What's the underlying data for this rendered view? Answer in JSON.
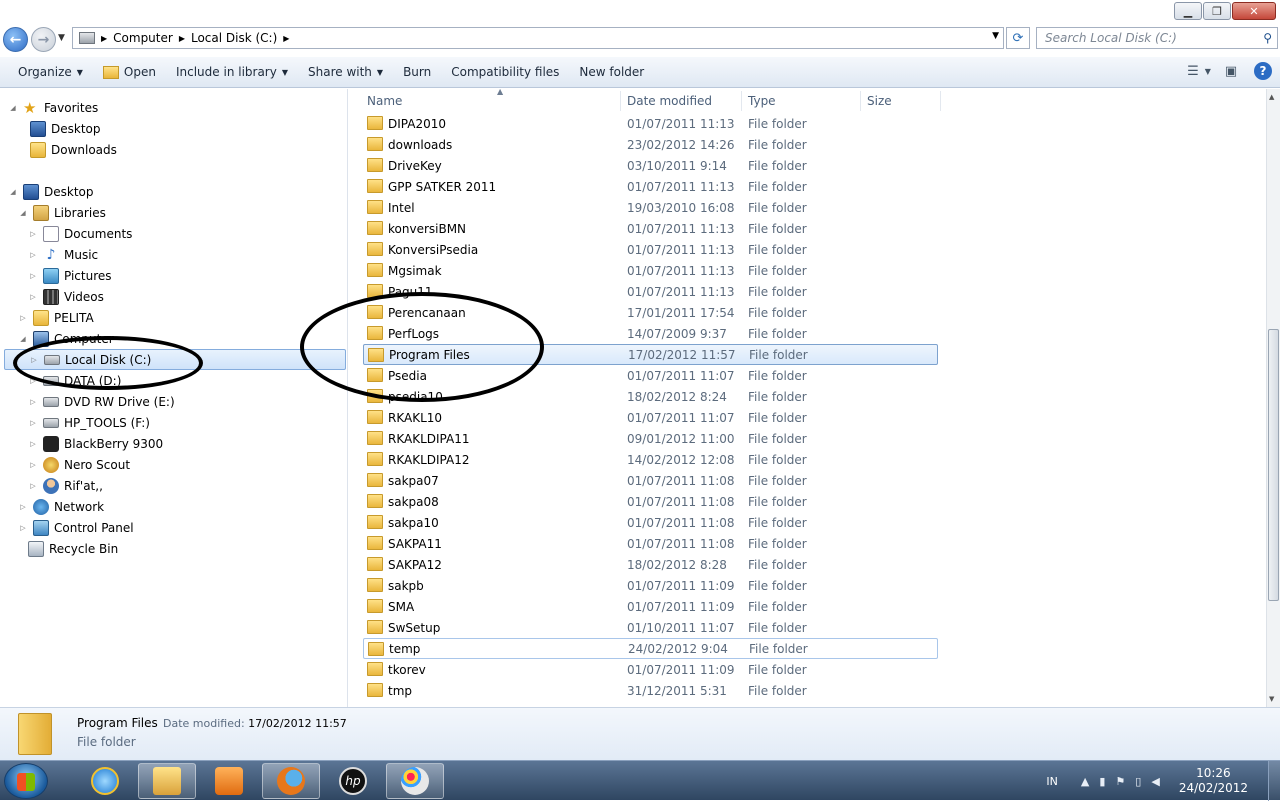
{
  "addressbar": {
    "segments": [
      "Computer",
      "Local Disk (C:)"
    ],
    "search_placeholder": "Search Local Disk (C:)"
  },
  "toolbar": {
    "organize": "Organize",
    "open": "Open",
    "include": "Include in library",
    "share": "Share with",
    "burn": "Burn",
    "compat": "Compatibility files",
    "newfolder": "New folder"
  },
  "nav": {
    "favorites": "Favorites",
    "fav_desktop": "Desktop",
    "fav_downloads": "Downloads",
    "desktop": "Desktop",
    "libraries": "Libraries",
    "documents": "Documents",
    "music": "Music",
    "pictures": "Pictures",
    "videos": "Videos",
    "pelita": "PELITA",
    "computer": "Computer",
    "local_disk": "Local Disk (C:)",
    "data_d": "DATA (D:)",
    "dvd": "DVD RW Drive (E:)",
    "hp_tools": "HP_TOOLS (F:)",
    "blackberry": "BlackBerry 9300",
    "nero": "Nero Scout",
    "rifat": "Rif'at,,",
    "network": "Network",
    "control_panel": "Control Panel",
    "recycle_bin": "Recycle Bin"
  },
  "columns": {
    "name": "Name",
    "date": "Date modified",
    "type": "Type",
    "size": "Size"
  },
  "files": [
    {
      "name": "DIPA2010",
      "date": "01/07/2011 11:13",
      "type": "File folder"
    },
    {
      "name": "downloads",
      "date": "23/02/2012 14:26",
      "type": "File folder"
    },
    {
      "name": "DriveKey",
      "date": "03/10/2011 9:14",
      "type": "File folder"
    },
    {
      "name": "GPP SATKER 2011",
      "date": "01/07/2011 11:13",
      "type": "File folder"
    },
    {
      "name": "Intel",
      "date": "19/03/2010 16:08",
      "type": "File folder"
    },
    {
      "name": "konversiBMN",
      "date": "01/07/2011 11:13",
      "type": "File folder"
    },
    {
      "name": "KonversiPsedia",
      "date": "01/07/2011 11:13",
      "type": "File folder"
    },
    {
      "name": "Mgsimak",
      "date": "01/07/2011 11:13",
      "type": "File folder"
    },
    {
      "name": "Pagu11",
      "date": "01/07/2011 11:13",
      "type": "File folder"
    },
    {
      "name": "Perencanaan",
      "date": "17/01/2011 17:54",
      "type": "File folder"
    },
    {
      "name": "PerfLogs",
      "date": "14/07/2009 9:37",
      "type": "File folder"
    },
    {
      "name": "Program Files",
      "date": "17/02/2012 11:57",
      "type": "File folder"
    },
    {
      "name": "Psedia",
      "date": "01/07/2011 11:07",
      "type": "File folder"
    },
    {
      "name": "psedia10",
      "date": "18/02/2012 8:24",
      "type": "File folder"
    },
    {
      "name": "RKAKL10",
      "date": "01/07/2011 11:07",
      "type": "File folder"
    },
    {
      "name": "RKAKLDIPA11",
      "date": "09/01/2012 11:00",
      "type": "File folder"
    },
    {
      "name": "RKAKLDIPA12",
      "date": "14/02/2012 12:08",
      "type": "File folder"
    },
    {
      "name": "sakpa07",
      "date": "01/07/2011 11:08",
      "type": "File folder"
    },
    {
      "name": "sakpa08",
      "date": "01/07/2011 11:08",
      "type": "File folder"
    },
    {
      "name": "sakpa10",
      "date": "01/07/2011 11:08",
      "type": "File folder"
    },
    {
      "name": "SAKPA11",
      "date": "01/07/2011 11:08",
      "type": "File folder"
    },
    {
      "name": "SAKPA12",
      "date": "18/02/2012 8:28",
      "type": "File folder"
    },
    {
      "name": "sakpb",
      "date": "01/07/2011 11:09",
      "type": "File folder"
    },
    {
      "name": "SMA",
      "date": "01/07/2011 11:09",
      "type": "File folder"
    },
    {
      "name": "SwSetup",
      "date": "01/10/2011 11:07",
      "type": "File folder"
    },
    {
      "name": "temp",
      "date": "24/02/2012 9:04",
      "type": "File folder"
    },
    {
      "name": "tkorev",
      "date": "01/07/2011 11:09",
      "type": "File folder"
    },
    {
      "name": "tmp",
      "date": "31/12/2011 5:31",
      "type": "File folder"
    }
  ],
  "details": {
    "name": "Program Files",
    "modified_label": "Date modified:",
    "modified_value": "17/02/2012 11:57",
    "type": "File folder"
  },
  "tray": {
    "lang": "IN",
    "time": "10:26",
    "date": "24/02/2012"
  }
}
